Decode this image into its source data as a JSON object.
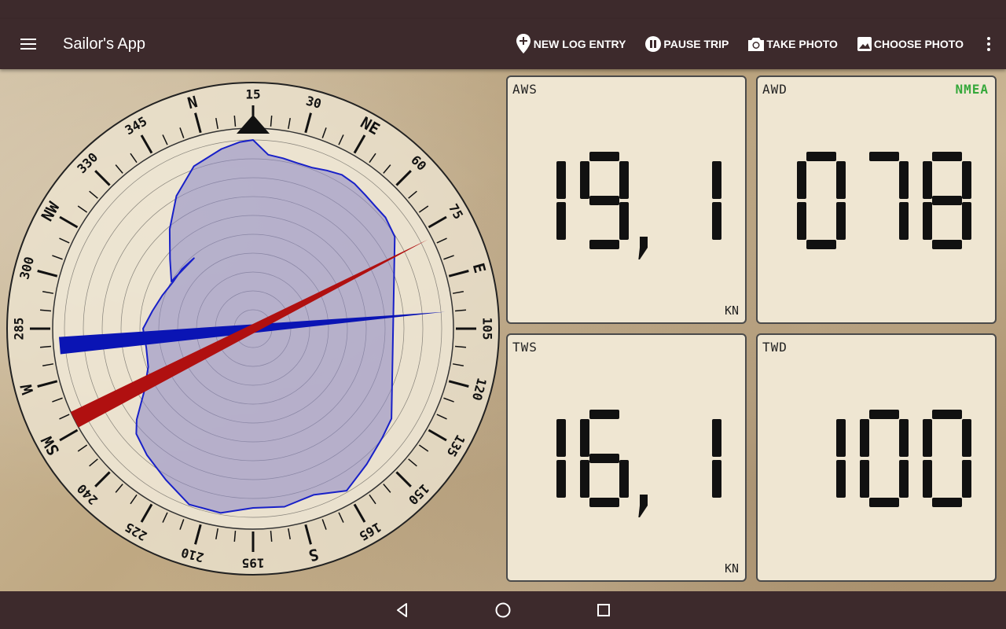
{
  "app": {
    "title": "Sailor's App"
  },
  "toolbar": {
    "actions": [
      {
        "label": "NEW LOG ENTRY",
        "icon": "add-location-icon"
      },
      {
        "label": "PAUSE TRIP",
        "icon": "pause-circle-icon"
      },
      {
        "label": "TAKE PHOTO",
        "icon": "camera-icon"
      },
      {
        "label": "CHOOSE PHOTO",
        "icon": "image-icon"
      }
    ]
  },
  "compass": {
    "bearing_labels": [
      "N",
      "15",
      "30",
      "NE",
      "60",
      "75",
      "E",
      "105",
      "120",
      "135",
      "150",
      "165",
      "S",
      "195",
      "210",
      "225",
      "240",
      "SW",
      "W",
      "285",
      "300",
      "NW",
      "330",
      "345"
    ],
    "heading": 15,
    "apparent_wind_direction": 78,
    "true_wind_direction": 100,
    "colors": {
      "apparent_needle": "#b01010",
      "true_needle": "#0a14b4",
      "polar_fill": "#8a86c6",
      "polar_stroke": "#1820c8"
    }
  },
  "tiles": {
    "aws": {
      "label": "AWS",
      "value": "19.1",
      "unit": "KN"
    },
    "awd": {
      "label": "AWD",
      "value": "078",
      "badge": "NMEA"
    },
    "tws": {
      "label": "TWS",
      "value": "16.1",
      "unit": "KN"
    },
    "twd": {
      "label": "TWD",
      "value": "100"
    }
  },
  "nav": {
    "buttons": [
      "back-icon",
      "home-icon",
      "recents-icon"
    ]
  }
}
